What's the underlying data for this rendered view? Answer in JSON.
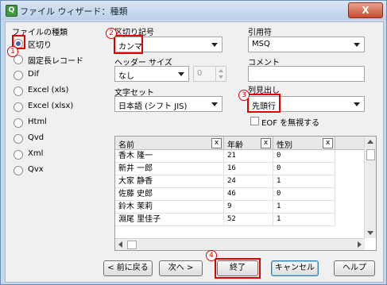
{
  "window": {
    "title": "ファイル ウィザード：種類",
    "close_label": "X"
  },
  "file_type": {
    "group_title": "ファイルの種類",
    "options": [
      {
        "label": "区切り",
        "selected": true
      },
      {
        "label": "固定長レコード",
        "selected": false
      },
      {
        "label": "Dif",
        "selected": false
      },
      {
        "label": "Excel (xls)",
        "selected": false
      },
      {
        "label": "Excel (xlsx)",
        "selected": false
      },
      {
        "label": "Html",
        "selected": false
      },
      {
        "label": "Qvd",
        "selected": false
      },
      {
        "label": "Xml",
        "selected": false
      },
      {
        "label": "Qvx",
        "selected": false
      }
    ]
  },
  "delimiter": {
    "label": "区切り記号",
    "value": "カンマ"
  },
  "quote": {
    "label": "引用符",
    "value": "MSQ"
  },
  "header_size": {
    "label": "ヘッダー サイズ",
    "value": "なし",
    "spin_value": "0"
  },
  "comment": {
    "label": "コメント",
    "value": ""
  },
  "charset": {
    "label": "文字セット",
    "value": "日本語 (シフト JIS)"
  },
  "labels": {
    "label": "列見出し",
    "value": "先頭行"
  },
  "ignore_eof": {
    "label": "EOF を無視する",
    "checked": false
  },
  "preview": {
    "columns": [
      "名前",
      "年齢",
      "性別"
    ],
    "rows": [
      [
        "香木 隆一",
        "21",
        "0"
      ],
      [
        "新井 一郎",
        "16",
        "0"
      ],
      [
        "大家 静香",
        "24",
        "1"
      ],
      [
        "佐藤 史郎",
        "46",
        "0"
      ],
      [
        "鈴木 茉莉",
        "9",
        "1"
      ],
      [
        "淵尾 里佳子",
        "52",
        "1"
      ]
    ],
    "close_label": "x"
  },
  "buttons": {
    "back": "< 前に戻る",
    "next": "次へ >",
    "finish": "終了",
    "cancel": "キャンセル",
    "help": "ヘルプ"
  },
  "markers": [
    "1",
    "2",
    "3",
    "4"
  ]
}
